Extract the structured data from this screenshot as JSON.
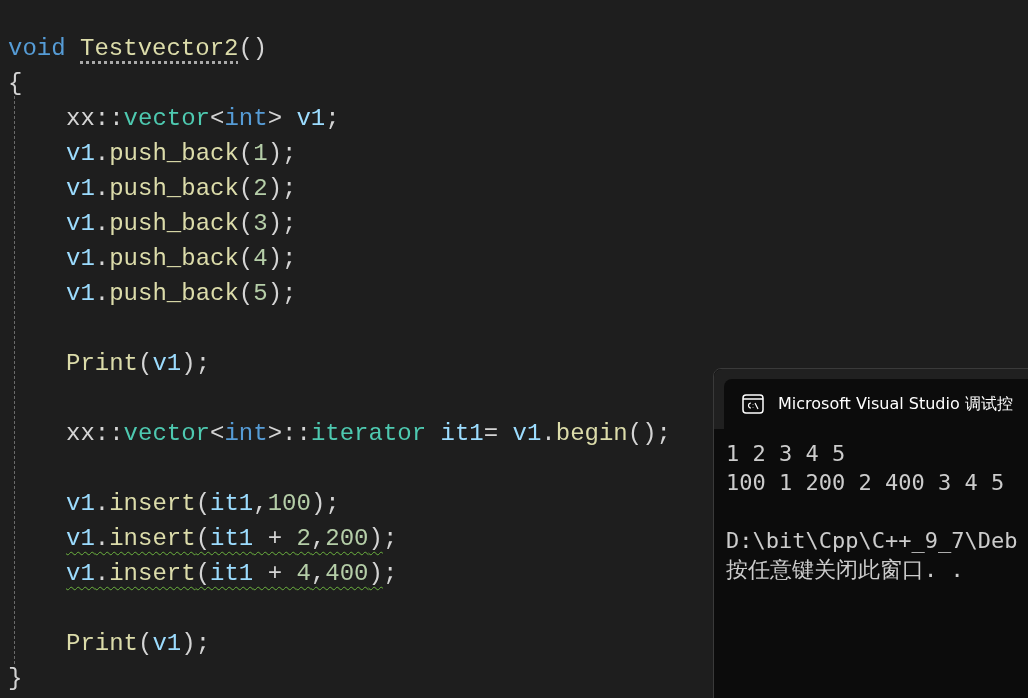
{
  "editor": {
    "signature": {
      "tokens": [
        {
          "kind": "keyword",
          "text": "void "
        },
        {
          "kind": "func",
          "text": "Testvector2",
          "hint": true
        },
        {
          "kind": "plain",
          "text": "()"
        }
      ]
    },
    "open": "{",
    "blocks": [
      {
        "lines": [
          {
            "tokens": [
              {
                "kind": "plain",
                "text": "xx::"
              },
              {
                "kind": "type",
                "text": "vector"
              },
              {
                "kind": "plain",
                "text": "<"
              },
              {
                "kind": "keyword",
                "text": "int"
              },
              {
                "kind": "plain",
                "text": "> "
              },
              {
                "kind": "var",
                "text": "v1"
              },
              {
                "kind": "plain",
                "text": ";"
              }
            ]
          },
          {
            "tokens": [
              {
                "kind": "var",
                "text": "v1"
              },
              {
                "kind": "plain",
                "text": "."
              },
              {
                "kind": "func",
                "text": "push_back"
              },
              {
                "kind": "plain",
                "text": "("
              },
              {
                "kind": "number",
                "text": "1"
              },
              {
                "kind": "plain",
                "text": ");"
              }
            ]
          },
          {
            "tokens": [
              {
                "kind": "var",
                "text": "v1"
              },
              {
                "kind": "plain",
                "text": "."
              },
              {
                "kind": "func",
                "text": "push_back"
              },
              {
                "kind": "plain",
                "text": "("
              },
              {
                "kind": "number",
                "text": "2"
              },
              {
                "kind": "plain",
                "text": ");"
              }
            ]
          },
          {
            "tokens": [
              {
                "kind": "var",
                "text": "v1"
              },
              {
                "kind": "plain",
                "text": "."
              },
              {
                "kind": "func",
                "text": "push_back"
              },
              {
                "kind": "plain",
                "text": "("
              },
              {
                "kind": "number",
                "text": "3"
              },
              {
                "kind": "plain",
                "text": ");"
              }
            ]
          },
          {
            "tokens": [
              {
                "kind": "var",
                "text": "v1"
              },
              {
                "kind": "plain",
                "text": "."
              },
              {
                "kind": "func",
                "text": "push_back"
              },
              {
                "kind": "plain",
                "text": "("
              },
              {
                "kind": "number",
                "text": "4"
              },
              {
                "kind": "plain",
                "text": ");"
              }
            ]
          },
          {
            "tokens": [
              {
                "kind": "var",
                "text": "v1"
              },
              {
                "kind": "plain",
                "text": "."
              },
              {
                "kind": "func",
                "text": "push_back"
              },
              {
                "kind": "plain",
                "text": "("
              },
              {
                "kind": "number",
                "text": "5"
              },
              {
                "kind": "plain",
                "text": ");"
              }
            ]
          }
        ]
      },
      {
        "lines": [
          {
            "tokens": [
              {
                "kind": "func",
                "text": "Print"
              },
              {
                "kind": "plain",
                "text": "("
              },
              {
                "kind": "var",
                "text": "v1"
              },
              {
                "kind": "plain",
                "text": ");"
              }
            ]
          }
        ]
      },
      {
        "lines": [
          {
            "tokens": [
              {
                "kind": "plain",
                "text": "xx::"
              },
              {
                "kind": "type",
                "text": "vector"
              },
              {
                "kind": "plain",
                "text": "<"
              },
              {
                "kind": "keyword",
                "text": "int"
              },
              {
                "kind": "plain",
                "text": ">::"
              },
              {
                "kind": "type",
                "text": "iterator"
              },
              {
                "kind": "var",
                "text": " it1"
              },
              {
                "kind": "plain",
                "text": "= "
              },
              {
                "kind": "var",
                "text": "v1"
              },
              {
                "kind": "plain",
                "text": "."
              },
              {
                "kind": "func",
                "text": "begin"
              },
              {
                "kind": "plain",
                "text": "();"
              }
            ]
          }
        ]
      },
      {
        "lines": [
          {
            "tokens": [
              {
                "kind": "var",
                "text": "v1"
              },
              {
                "kind": "plain",
                "text": "."
              },
              {
                "kind": "func",
                "text": "insert"
              },
              {
                "kind": "plain",
                "text": "("
              },
              {
                "kind": "var",
                "text": "it1"
              },
              {
                "kind": "plain",
                "text": ","
              },
              {
                "kind": "number",
                "text": "100"
              },
              {
                "kind": "plain",
                "text": ");"
              }
            ]
          },
          {
            "warning": true,
            "tokens": [
              {
                "kind": "var",
                "text": "v1"
              },
              {
                "kind": "plain",
                "text": "."
              },
              {
                "kind": "func",
                "text": "insert"
              },
              {
                "kind": "plain",
                "text": "("
              },
              {
                "kind": "var",
                "text": "it1"
              },
              {
                "kind": "plain",
                "text": " + "
              },
              {
                "kind": "number",
                "text": "2"
              },
              {
                "kind": "plain",
                "text": ","
              },
              {
                "kind": "number",
                "text": "200"
              },
              {
                "kind": "plain",
                "text": ")"
              }
            ],
            "tail": ";"
          },
          {
            "warning": true,
            "tokens": [
              {
                "kind": "var",
                "text": "v1"
              },
              {
                "kind": "plain",
                "text": "."
              },
              {
                "kind": "func",
                "text": "insert"
              },
              {
                "kind": "plain",
                "text": "("
              },
              {
                "kind": "var",
                "text": "it1"
              },
              {
                "kind": "plain",
                "text": " + "
              },
              {
                "kind": "number",
                "text": "4"
              },
              {
                "kind": "plain",
                "text": ","
              },
              {
                "kind": "number",
                "text": "400"
              },
              {
                "kind": "plain",
                "text": ")"
              }
            ],
            "tail": ";"
          }
        ]
      },
      {
        "lines": [
          {
            "tokens": [
              {
                "kind": "func",
                "text": "Print"
              },
              {
                "kind": "plain",
                "text": "("
              },
              {
                "kind": "var",
                "text": "v1"
              },
              {
                "kind": "plain",
                "text": ");"
              }
            ]
          }
        ]
      }
    ],
    "close": "}"
  },
  "console": {
    "title": "Microsoft Visual Studio 调试控",
    "output": [
      "1 2 3 4 5",
      "100 1 200 2 400 3 4 5"
    ],
    "prompt": [
      "D:\\bit\\Cpp\\C++_9_7\\Deb",
      "按任意键关闭此窗口. ."
    ]
  }
}
